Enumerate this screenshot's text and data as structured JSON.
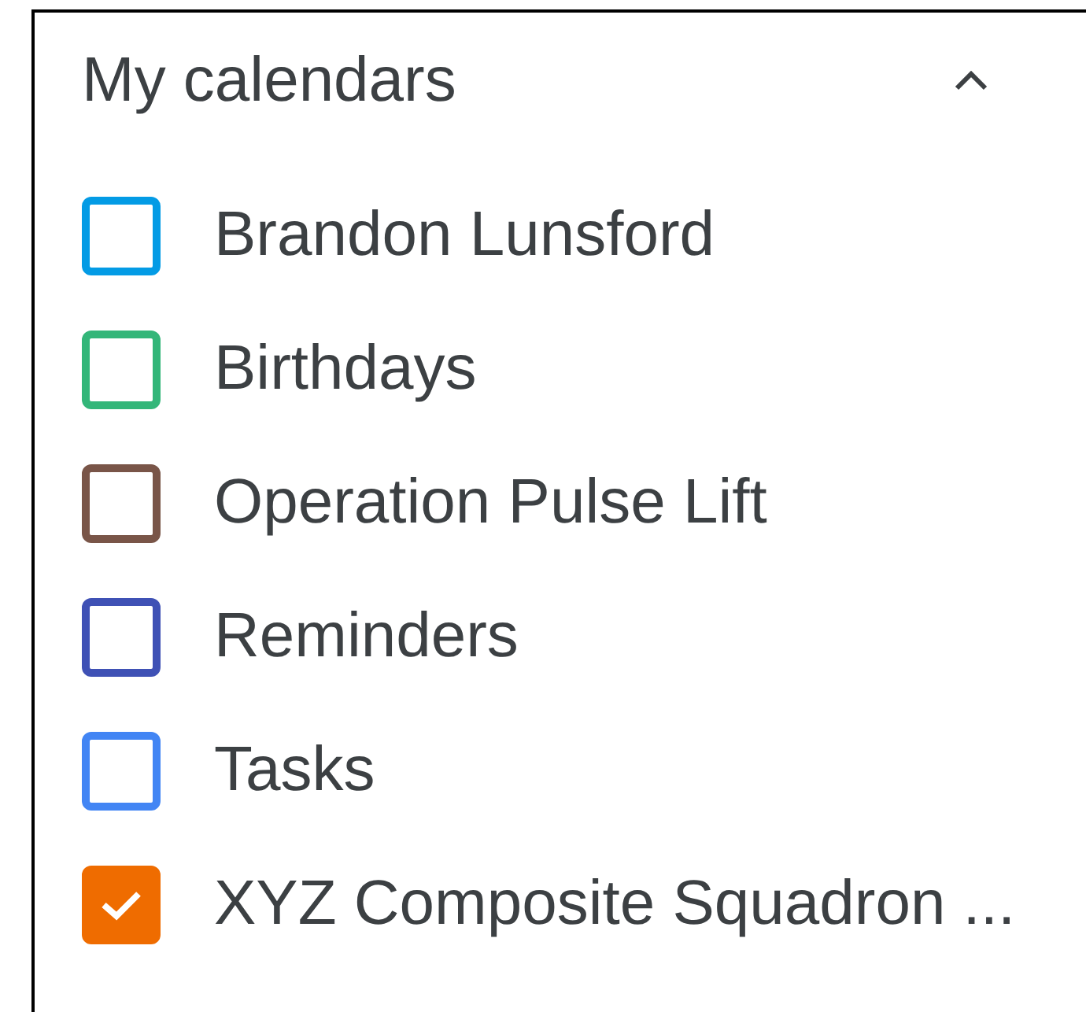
{
  "section": {
    "title": "My calendars",
    "expanded": true
  },
  "calendars": [
    {
      "name": "Brandon Lunsford",
      "checked": false,
      "color": "#039be5"
    },
    {
      "name": "Birthdays",
      "checked": false,
      "color": "#33b679"
    },
    {
      "name": "Operation Pulse Lift",
      "checked": false,
      "color": "#795548"
    },
    {
      "name": "Reminders",
      "checked": false,
      "color": "#3f51b5"
    },
    {
      "name": "Tasks",
      "checked": false,
      "color": "#4285f4"
    },
    {
      "name": "XYZ Composite Squadron ...",
      "checked": true,
      "color": "#ef6c00"
    }
  ]
}
